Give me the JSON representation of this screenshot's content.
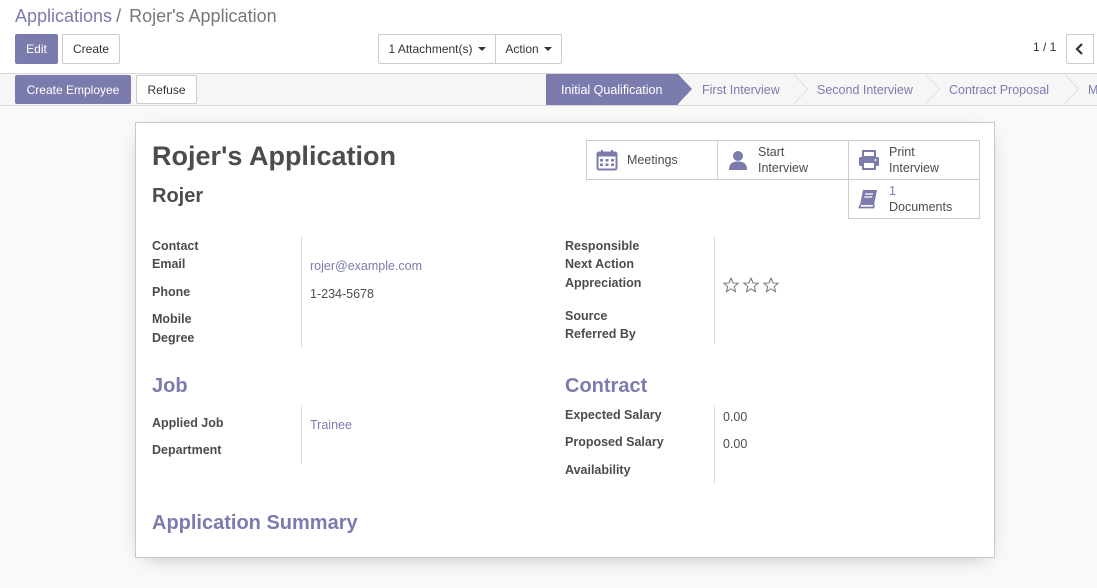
{
  "breadcrumb": {
    "parent": "Applications",
    "separator": "/",
    "current": "Rojer's Application"
  },
  "buttons": {
    "edit": "Edit",
    "create": "Create",
    "attachments": "1 Attachment(s)",
    "action": "Action"
  },
  "pager": {
    "value": "1 / 1"
  },
  "statusbar": {
    "create_employee": "Create Employee",
    "refuse": "Refuse",
    "stages": [
      "Initial Qualification",
      "First Interview",
      "Second Interview",
      "Contract Proposal",
      "M"
    ],
    "active_stage_index": 0
  },
  "smart_buttons": {
    "meetings": "Meetings",
    "start_interview": [
      "Start",
      "Interview"
    ],
    "print_interview": [
      "Print",
      "Interview"
    ],
    "documents": {
      "count": "1",
      "label": "Documents"
    }
  },
  "form": {
    "title": "Rojer's Application",
    "applicant": "Rojer",
    "labels": {
      "contact": "Contact",
      "email": "Email",
      "phone": "Phone",
      "mobile": "Mobile",
      "degree": "Degree",
      "responsible": "Responsible",
      "next_action": "Next Action",
      "appreciation": "Appreciation",
      "source": "Source",
      "referred_by": "Referred By",
      "applied_job": "Applied Job",
      "department": "Department",
      "expected_salary": "Expected Salary",
      "proposed_salary": "Proposed Salary",
      "availability": "Availability"
    },
    "values": {
      "email": "rojer@example.com",
      "phone": "1-234-5678",
      "applied_job": "Trainee",
      "expected_salary": "0.00",
      "proposed_salary": "0.00"
    },
    "appreciation_stars": {
      "filled": 0,
      "total": 3
    },
    "sections": {
      "job": "Job",
      "contract": "Contract",
      "summary": "Application Summary"
    }
  },
  "colors": {
    "accent": "#7c7bad",
    "text": "#4c4c4c",
    "border": "#d9d9d9"
  },
  "icons": {
    "calendar": "calendar-icon",
    "user": "user-icon",
    "print": "print-icon",
    "book": "book-icon",
    "star": "star-icon",
    "chevron_left": "chevron-left-icon"
  }
}
